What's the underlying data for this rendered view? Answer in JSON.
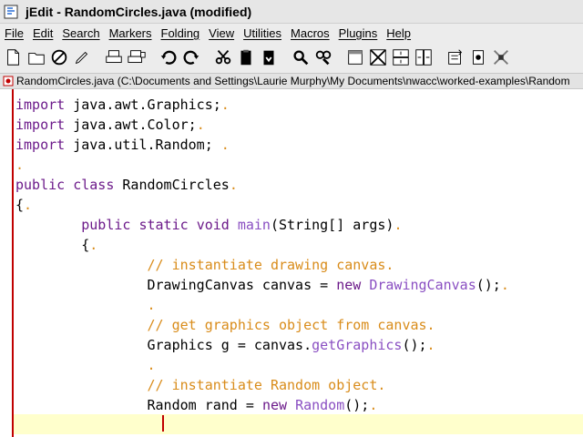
{
  "window": {
    "title": "jEdit - RandomCircles.java (modified)"
  },
  "menu": [
    {
      "id": "file",
      "label": "File"
    },
    {
      "id": "edit",
      "label": "Edit"
    },
    {
      "id": "search",
      "label": "Search"
    },
    {
      "id": "markers",
      "label": "Markers"
    },
    {
      "id": "folding",
      "label": "Folding"
    },
    {
      "id": "view",
      "label": "View"
    },
    {
      "id": "utilities",
      "label": "Utilities"
    },
    {
      "id": "macros",
      "label": "Macros"
    },
    {
      "id": "plugins",
      "label": "Plugins"
    },
    {
      "id": "help",
      "label": "Help"
    }
  ],
  "toolbar": [
    {
      "name": "new-file-icon"
    },
    {
      "name": "open-file-icon"
    },
    {
      "name": "close-file-icon"
    },
    {
      "name": "edit-pencil-icon"
    },
    {
      "name": "print-icon"
    },
    {
      "name": "print-preview-icon"
    },
    {
      "name": "undo-icon"
    },
    {
      "name": "redo-icon"
    },
    {
      "name": "cut-icon"
    },
    {
      "name": "copy-icon"
    },
    {
      "name": "paste-icon"
    },
    {
      "name": "find-icon"
    },
    {
      "name": "find-next-icon"
    },
    {
      "name": "new-view-icon"
    },
    {
      "name": "split-both-icon"
    },
    {
      "name": "split-horizontal-icon"
    },
    {
      "name": "split-vertical-icon"
    },
    {
      "name": "global-options-icon"
    },
    {
      "name": "plugin-manager-icon"
    },
    {
      "name": "help-icon"
    }
  ],
  "buffer": {
    "path": "RandomCircles.java (C:\\Documents and Settings\\Laurie Murphy\\My Documents\\nwacc\\worked-examples\\Random"
  },
  "code_lines": [
    [
      {
        "t": "import",
        "c": "kw"
      },
      {
        "t": " java.awt.Graphics;",
        "c": ""
      },
      {
        "t": ".",
        "c": "dot"
      }
    ],
    [
      {
        "t": "import",
        "c": "kw"
      },
      {
        "t": " java.awt.Color;",
        "c": ""
      },
      {
        "t": ".",
        "c": "dot"
      }
    ],
    [
      {
        "t": "import",
        "c": "kw"
      },
      {
        "t": " java.util.Random; ",
        "c": ""
      },
      {
        "t": ".",
        "c": "dot"
      }
    ],
    [
      {
        "t": ".",
        "c": "dot"
      }
    ],
    [
      {
        "t": "public",
        "c": "kw"
      },
      {
        "t": " ",
        "c": ""
      },
      {
        "t": "class",
        "c": "kw"
      },
      {
        "t": " RandomCircles",
        "c": ""
      },
      {
        "t": ".",
        "c": "dot"
      }
    ],
    [
      {
        "t": "{",
        "c": ""
      },
      {
        "t": ".",
        "c": "dot"
      }
    ],
    [
      {
        "t": "        ",
        "c": ""
      },
      {
        "t": "public",
        "c": "kw"
      },
      {
        "t": " ",
        "c": ""
      },
      {
        "t": "static",
        "c": "kw"
      },
      {
        "t": " ",
        "c": ""
      },
      {
        "t": "void",
        "c": "kw"
      },
      {
        "t": " ",
        "c": ""
      },
      {
        "t": "main",
        "c": "fn"
      },
      {
        "t": "(String[] args)",
        "c": ""
      },
      {
        "t": ".",
        "c": "dot"
      }
    ],
    [
      {
        "t": "        {",
        "c": ""
      },
      {
        "t": ".",
        "c": "dot"
      }
    ],
    [
      {
        "t": "                ",
        "c": ""
      },
      {
        "t": "// instantiate drawing canvas",
        "c": "cm"
      },
      {
        "t": ".",
        "c": "dot"
      }
    ],
    [
      {
        "t": "                DrawingCanvas canvas = ",
        "c": ""
      },
      {
        "t": "new",
        "c": "kw"
      },
      {
        "t": " ",
        "c": ""
      },
      {
        "t": "DrawingCanvas",
        "c": "fn"
      },
      {
        "t": "();",
        "c": ""
      },
      {
        "t": ".",
        "c": "dot"
      }
    ],
    [
      {
        "t": "                ",
        "c": ""
      },
      {
        "t": ".",
        "c": "dot"
      }
    ],
    [
      {
        "t": "                ",
        "c": ""
      },
      {
        "t": "// get graphics object from canvas",
        "c": "cm"
      },
      {
        "t": ".",
        "c": "dot"
      }
    ],
    [
      {
        "t": "                Graphics g = canvas.",
        "c": ""
      },
      {
        "t": "getGraphics",
        "c": "fn"
      },
      {
        "t": "();",
        "c": ""
      },
      {
        "t": ".",
        "c": "dot"
      }
    ],
    [
      {
        "t": "                ",
        "c": ""
      },
      {
        "t": ".",
        "c": "dot"
      }
    ],
    [
      {
        "t": "                ",
        "c": ""
      },
      {
        "t": "// instantiate Random object",
        "c": "cm"
      },
      {
        "t": ".",
        "c": "dot"
      }
    ],
    [
      {
        "t": "                Random rand = ",
        "c": ""
      },
      {
        "t": "new",
        "c": "kw"
      },
      {
        "t": " ",
        "c": ""
      },
      {
        "t": "Random",
        "c": "fn"
      },
      {
        "t": "();",
        "c": ""
      },
      {
        "t": ".",
        "c": "dot"
      }
    ],
    [
      {
        "t": "                ",
        "c": ""
      }
    ]
  ],
  "colors": {
    "keyword": "#6c1a8a",
    "comment": "#d98c1a",
    "function": "#8a4fc2",
    "current_line": "#ffffcc",
    "gutter": "#c00000"
  }
}
